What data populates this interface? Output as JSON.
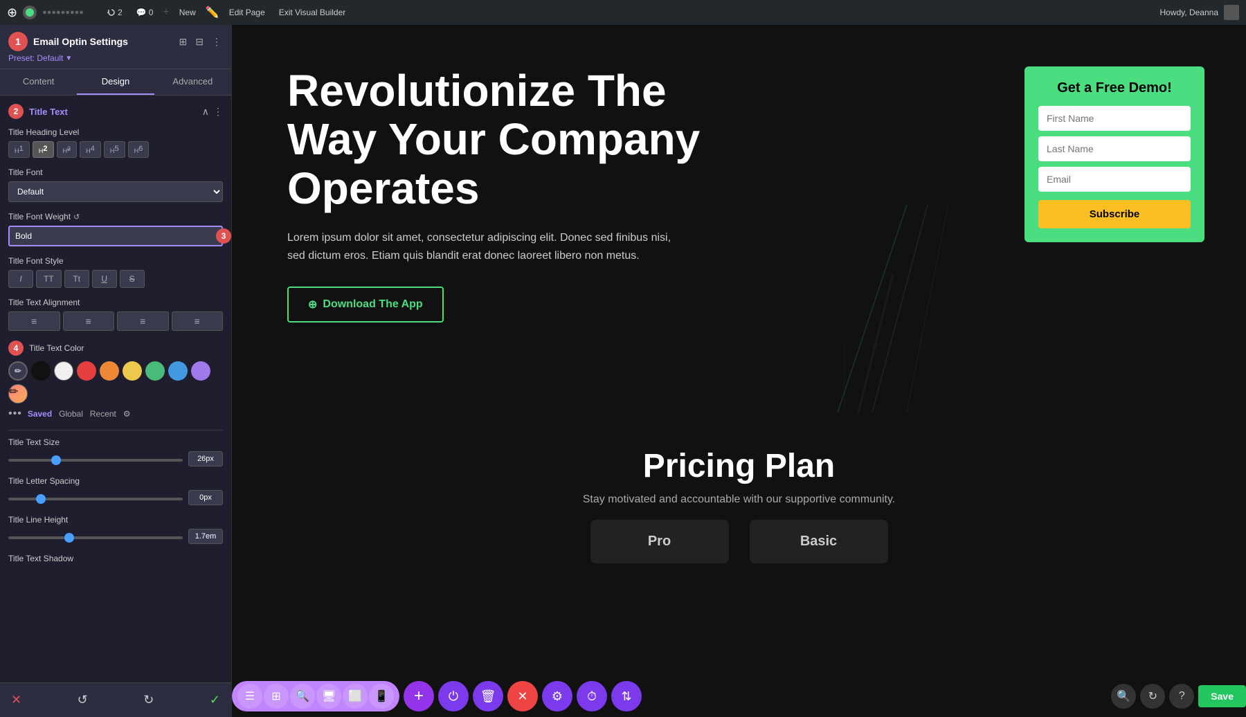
{
  "topbar": {
    "wp_icon": "ⓦ",
    "site_icon": "S",
    "url": "●●●●●●●●●",
    "sync_count": "2",
    "comment_count": "0",
    "new_label": "New",
    "edit_page_label": "Edit Page",
    "exit_vb_label": "Exit Visual Builder",
    "howdy_text": "Howdy, Deanna",
    "save_label": "Save"
  },
  "panel": {
    "title": "Email Optin Settings",
    "preset_label": "Preset: Default",
    "tabs": [
      "Content",
      "Design",
      "Advanced"
    ],
    "active_tab": "Design",
    "section_title": "Title Text",
    "badge1": "1",
    "badge2": "2",
    "badge3": "3",
    "badge4": "4",
    "heading_levels": [
      "H1",
      "H2",
      "H2",
      "H4",
      "H5",
      "H6"
    ],
    "active_heading": 1,
    "title_font_label": "Title Font",
    "title_font_value": "Default",
    "title_font_weight_label": "Title Font Weight",
    "title_font_weight_value": "Bold",
    "title_font_style_label": "Title Font Style",
    "font_styles": [
      "I",
      "TT",
      "Tt",
      "U",
      "S"
    ],
    "title_text_align_label": "Title Text Alignment",
    "title_text_color_label": "Title Text Color",
    "color_tabs": [
      "Saved",
      "Global",
      "Recent"
    ],
    "active_color_tab": "Saved",
    "swatches": [
      {
        "color": "#2d2d2d",
        "label": "dark-pencil",
        "active": true,
        "is_pencil": true
      },
      {
        "color": "#1a1a1a",
        "label": "black"
      },
      {
        "color": "#ffffff",
        "label": "white"
      },
      {
        "color": "#e53e3e",
        "label": "red"
      },
      {
        "color": "#ed8936",
        "label": "orange"
      },
      {
        "color": "#ecc94b",
        "label": "yellow"
      },
      {
        "color": "#48bb78",
        "label": "green"
      },
      {
        "color": "#4299e1",
        "label": "blue"
      },
      {
        "color": "#9f7aea",
        "label": "purple"
      },
      {
        "color": "#fc8181",
        "label": "pink-pencil",
        "is_pencil_last": true
      }
    ],
    "title_text_size_label": "Title Text Size",
    "title_text_size_value": "26px",
    "title_text_size_min": 0,
    "title_text_size_max": 100,
    "title_text_size_pos": 26,
    "title_letter_spacing_label": "Title Letter Spacing",
    "title_letter_spacing_value": "0px",
    "title_letter_spacing_pos": 0,
    "title_line_height_label": "Title Line Height",
    "title_line_height_value": "1.7em",
    "title_line_height_pos": 40,
    "title_text_shadow_label": "Title Text Shadow"
  },
  "preview": {
    "hero_title": "Revolutionize The Way Your Company Operates",
    "hero_desc": "Lorem ipsum dolor sit amet, consectetur adipiscing elit. Donec sed finibus nisi, sed dictum eros. Etiam quis blandit erat donec laoreet libero non metus.",
    "hero_cta": "Download The App",
    "form_title": "Get a Free Demo!",
    "form_firstname_placeholder": "First Name",
    "form_lastname_placeholder": "Last Name",
    "form_email_placeholder": "Email",
    "form_submit": "Subscribe",
    "pricing_title": "Pricing Plan",
    "pricing_subtitle": "Stay motivated and accountable with our supportive community.",
    "pricing_pro": "Pro",
    "pricing_basic": "Basic"
  }
}
